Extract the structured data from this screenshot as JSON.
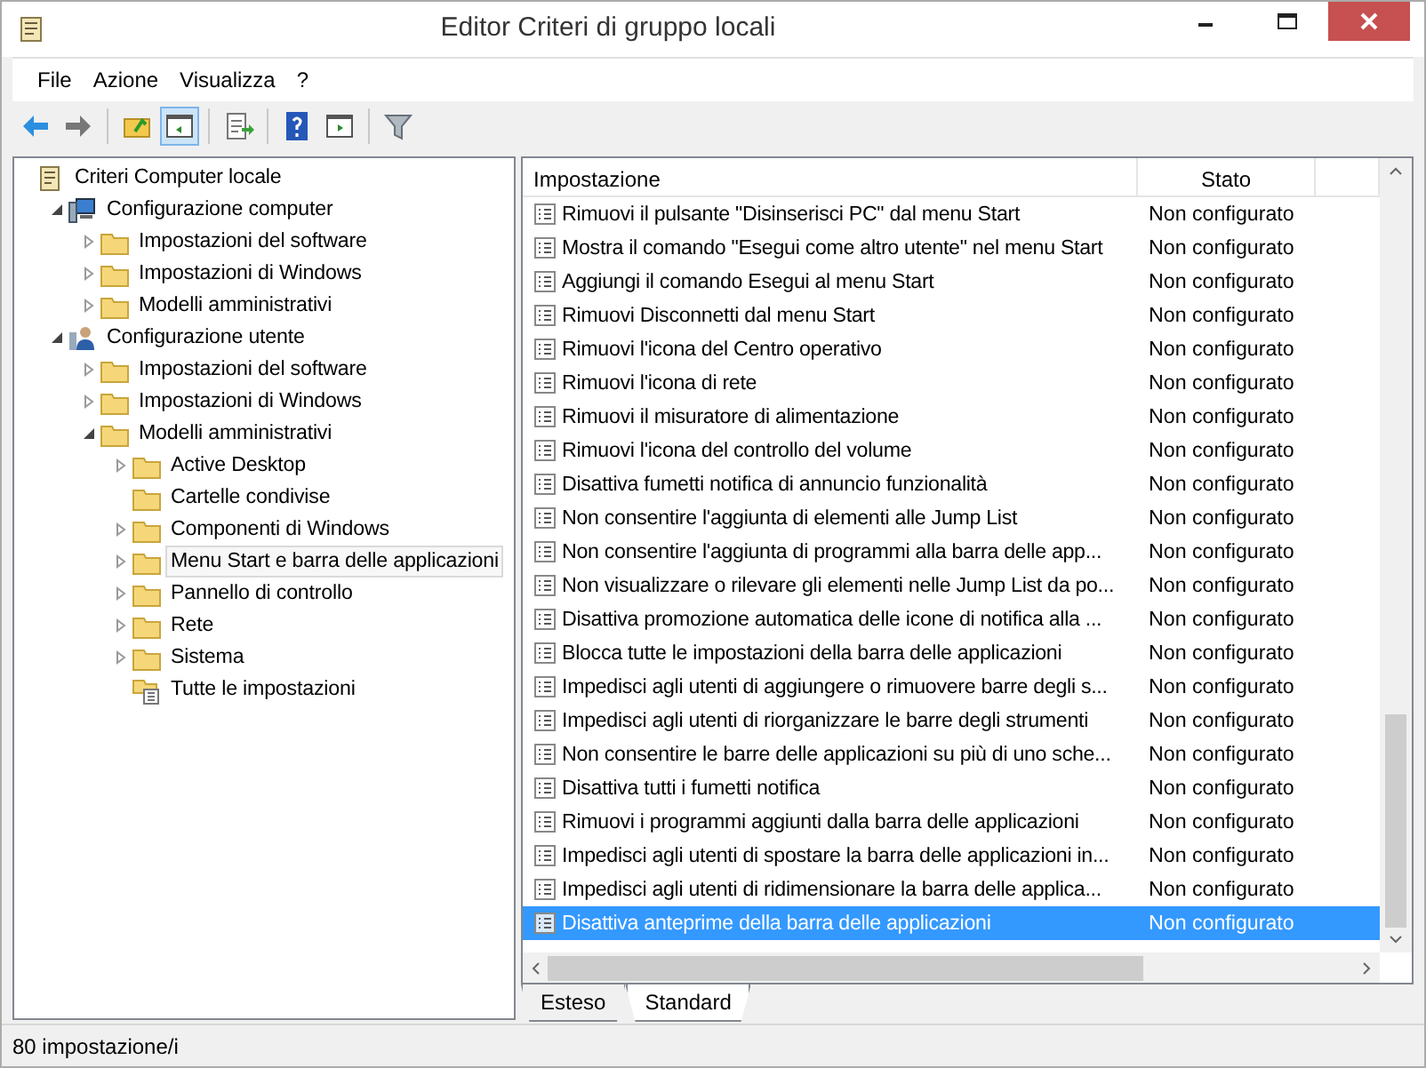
{
  "window": {
    "title": "Editor Criteri di gruppo locali"
  },
  "menu": [
    "File",
    "Azione",
    "Visualizza",
    "?"
  ],
  "toolbar": [
    [
      {
        "kind": "back",
        "pressed": false
      },
      {
        "kind": "forward",
        "pressed": false
      }
    ],
    [
      {
        "kind": "up",
        "pressed": false
      },
      {
        "kind": "tree",
        "pressed": true
      }
    ],
    [
      {
        "kind": "export",
        "pressed": false
      }
    ],
    [
      {
        "kind": "help",
        "pressed": false
      },
      {
        "kind": "panel",
        "pressed": false
      }
    ],
    [
      {
        "kind": "filter",
        "pressed": false
      }
    ]
  ],
  "tree": [
    {
      "label": "Criteri Computer locale",
      "kind": "policy",
      "selected": false,
      "children": [
        {
          "label": "Configurazione computer",
          "kind": "computer",
          "expanded": true,
          "selected": false,
          "children": [
            {
              "label": "Impostazioni del software",
              "kind": "folder",
              "expanded": false,
              "selected": false
            },
            {
              "label": "Impostazioni di Windows",
              "kind": "folder",
              "expanded": false,
              "selected": false
            },
            {
              "label": "Modelli amministrativi",
              "kind": "folder",
              "expanded": false,
              "selected": false
            }
          ]
        },
        {
          "label": "Configurazione utente",
          "kind": "user",
          "expanded": true,
          "selected": false,
          "children": [
            {
              "label": "Impostazioni del software",
              "kind": "folder",
              "expanded": false,
              "selected": false
            },
            {
              "label": "Impostazioni di Windows",
              "kind": "folder",
              "expanded": false,
              "selected": false
            },
            {
              "label": "Modelli amministrativi",
              "kind": "folder",
              "expanded": true,
              "selected": false,
              "children": [
                {
                  "label": "Active Desktop",
                  "kind": "folder",
                  "expanded": false,
                  "selected": false
                },
                {
                  "label": "Cartelle condivise",
                  "kind": "folder",
                  "selected": false
                },
                {
                  "label": "Componenti di Windows",
                  "kind": "folder",
                  "expanded": false,
                  "selected": false
                },
                {
                  "label": "Menu Start e barra delle applicazioni",
                  "kind": "folder",
                  "expanded": false,
                  "selected": true
                },
                {
                  "label": "Pannello di controllo",
                  "kind": "folder",
                  "expanded": false,
                  "selected": false
                },
                {
                  "label": "Rete",
                  "kind": "folder",
                  "expanded": false,
                  "selected": false
                },
                {
                  "label": "Sistema",
                  "kind": "folder",
                  "expanded": false,
                  "selected": false
                },
                {
                  "label": "Tutte le impostazioni",
                  "kind": "settings",
                  "selected": false
                }
              ]
            }
          ]
        }
      ]
    }
  ],
  "table": {
    "columns": [
      "Impostazione",
      "Stato"
    ],
    "rows": [
      {
        "name": "Rimuovi il pulsante \"Disinserisci PC\" dal menu Start",
        "state": "Non configurato",
        "selected": false
      },
      {
        "name": "Mostra il comando \"Esegui come altro utente\" nel menu Start",
        "state": "Non configurato",
        "selected": false
      },
      {
        "name": "Aggiungi il comando Esegui al menu Start",
        "state": "Non configurato",
        "selected": false
      },
      {
        "name": "Rimuovi Disconnetti dal menu Start",
        "state": "Non configurato",
        "selected": false
      },
      {
        "name": "Rimuovi l'icona del Centro operativo",
        "state": "Non configurato",
        "selected": false
      },
      {
        "name": "Rimuovi l'icona di rete",
        "state": "Non configurato",
        "selected": false
      },
      {
        "name": "Rimuovi il misuratore di alimentazione",
        "state": "Non configurato",
        "selected": false
      },
      {
        "name": "Rimuovi l'icona del controllo del volume",
        "state": "Non configurato",
        "selected": false
      },
      {
        "name": "Disattiva fumetti notifica di annuncio funzionalità",
        "state": "Non configurato",
        "selected": false
      },
      {
        "name": "Non consentire l'aggiunta di elementi alle Jump List",
        "state": "Non configurato",
        "selected": false
      },
      {
        "name": "Non consentire l'aggiunta di programmi alla barra delle app...",
        "state": "Non configurato",
        "selected": false
      },
      {
        "name": "Non visualizzare o rilevare gli elementi nelle Jump List da po...",
        "state": "Non configurato",
        "selected": false
      },
      {
        "name": "Disattiva promozione automatica delle icone di notifica alla ...",
        "state": "Non configurato",
        "selected": false
      },
      {
        "name": "Blocca tutte le impostazioni della barra delle applicazioni",
        "state": "Non configurato",
        "selected": false
      },
      {
        "name": "Impedisci agli utenti di aggiungere o rimuovere barre degli s...",
        "state": "Non configurato",
        "selected": false
      },
      {
        "name": "Impedisci agli utenti di riorganizzare le barre degli strumenti",
        "state": "Non configurato",
        "selected": false
      },
      {
        "name": "Non consentire le barre delle applicazioni su più di uno sche...",
        "state": "Non configurato",
        "selected": false
      },
      {
        "name": "Disattiva tutti i fumetti notifica",
        "state": "Non configurato",
        "selected": false
      },
      {
        "name": "Rimuovi i programmi aggiunti dalla barra delle applicazioni",
        "state": "Non configurato",
        "selected": false
      },
      {
        "name": "Impedisci agli utenti di spostare la barra delle applicazioni in...",
        "state": "Non configurato",
        "selected": false
      },
      {
        "name": "Impedisci agli utenti di ridimensionare la barra delle applica...",
        "state": "Non configurato",
        "selected": false
      },
      {
        "name": "Disattiva anteprime della barra delle applicazioni",
        "state": "Non configurato",
        "selected": true
      }
    ]
  },
  "tabs": [
    {
      "label": "Esteso",
      "selected": false
    },
    {
      "label": "Standard",
      "selected": true
    }
  ],
  "status_bar": "80 impostazione/i"
}
